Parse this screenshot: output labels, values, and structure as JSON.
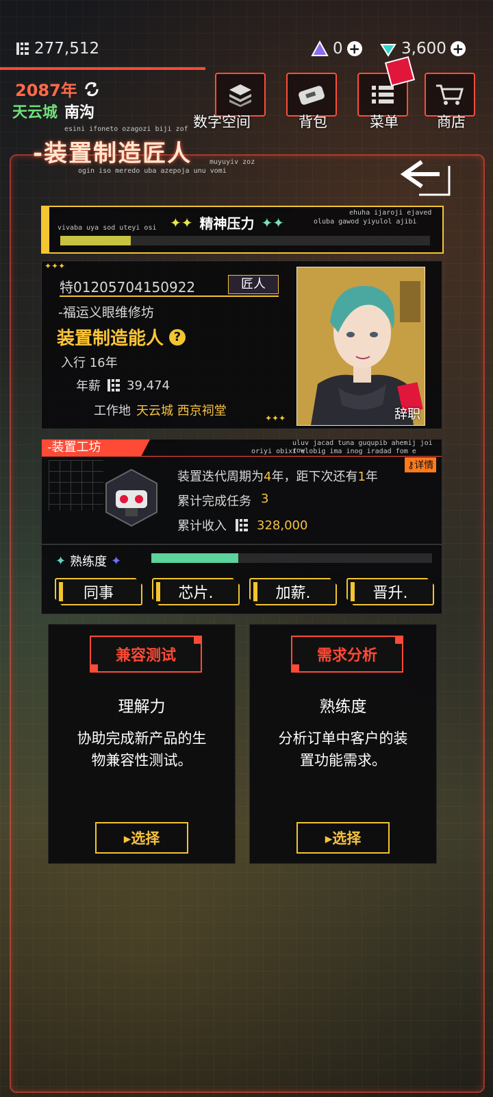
{
  "currency": {
    "money": "277,512",
    "gems_a": "0",
    "gems_b": "3,600"
  },
  "time": {
    "year": "2087年",
    "city": "天云城",
    "district": "南沟"
  },
  "nav": {
    "digital": "数字空间",
    "bag": "背包",
    "menu": "菜单",
    "shop": "商店"
  },
  "title": {
    "main": "-装置制造匠人",
    "sub_top": "esini ifoneto ozagozi biji zof",
    "sub_right": "muyuyiv zoz",
    "sub_bottom": "ogin iso meredo uba azepoja unu vomi"
  },
  "stress": {
    "label": "精神压力",
    "left_small": "vivaba uya sod uteyi osi",
    "right_small_1": "ehuha ijaroji ejaved",
    "right_small_2": "oluba gawod yiyulol ajibi",
    "level": 0.19
  },
  "profile": {
    "id": "特01205704150922",
    "tag": "匠人",
    "company": "-福运义眼维修坊",
    "title": "装置制造能人",
    "help": "?",
    "years": "入行 16年",
    "salary_label": "年薪",
    "salary": "39,474",
    "workplace_label": "工作地",
    "workplace_value": "天云城 西京祠堂",
    "resign": "辞职"
  },
  "workshop": {
    "header": "-装置工坊",
    "small_1": "uluv jacad tuna guqupib ahemij joi row",
    "small_2": "oriyi obixi elobig ima inog iradad fom e",
    "detail": "详情",
    "cycle_pre": "装置迭代周期为",
    "cycle_years": "4",
    "cycle_mid": "年，距下次还有",
    "cycle_left": "1",
    "cycle_post": "年",
    "tasks_label": "累计完成任务",
    "tasks_value": "3",
    "income_label": "累计收入",
    "income_value": "328,000",
    "mastery_label": "熟练度",
    "mastery_level": 0.31
  },
  "actions": [
    "同事",
    "芯片.",
    "加薪.",
    "晋升."
  ],
  "tasks": [
    {
      "title": "兼容测试",
      "skill": "理解力",
      "desc": "协助完成新产品的生物兼容性测试。",
      "button": "▸选择"
    },
    {
      "title": "需求分析",
      "skill": "熟练度",
      "desc": "分析订单中客户的装置功能需求。",
      "button": "▸选择"
    }
  ],
  "colors": {
    "accent": "#ff4a35",
    "gold": "#f2c531",
    "green": "#5bd39a"
  }
}
